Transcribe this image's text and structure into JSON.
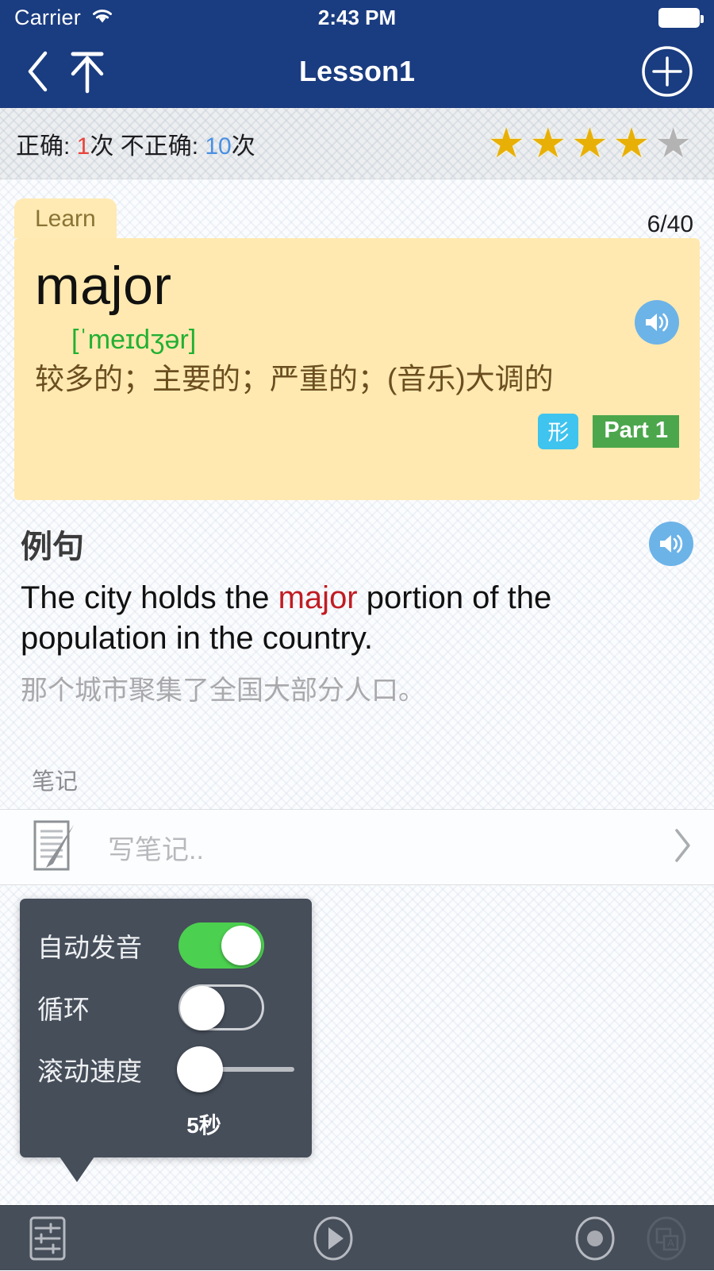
{
  "status_bar": {
    "carrier": "Carrier",
    "time": "2:43 PM",
    "wifi_icon": "wifi-icon",
    "battery_icon": "battery-full-icon"
  },
  "nav_bar": {
    "title": "Lesson1",
    "back_icon": "chevron-left-icon",
    "scroll_to_top_icon": "arrow-up-to-line-icon",
    "add_icon": "plus-circle-icon"
  },
  "stats": {
    "correct_label": "正确: ",
    "correct_count": "1",
    "correct_unit": "次 ",
    "incorrect_label": "不正确: ",
    "incorrect_count": "10",
    "incorrect_unit": "次",
    "stars_filled": 4,
    "stars_total": 5,
    "star_filled_color": "#e8b006",
    "star_empty_color": "#b3b3b3"
  },
  "card": {
    "tab_label": "Learn",
    "counter": "6/40",
    "word": "major",
    "phonetic": "[ˈmeɪdʒər]",
    "definition": "较多的；主要的；严重的；(音乐)大调的",
    "pos_badge": "形",
    "part_badge": "Part 1",
    "speaker_icon": "speaker-icon",
    "card_color": "#ffe9b0",
    "phonetic_color": "#22b032",
    "pos_badge_color": "#3fc3ef",
    "part_badge_color": "#4ca64c"
  },
  "example": {
    "title": "例句",
    "sentence_before": "The city holds the ",
    "sentence_highlight": "major",
    "sentence_after": " portion of the population in the country.",
    "translation": "那个城市聚集了全国大部分人口。",
    "speaker_icon": "speaker-icon",
    "highlight_color": "#c01c22"
  },
  "notes": {
    "section_label": "笔记",
    "placeholder": "写笔记..",
    "icon": "note-pencil-icon",
    "chevron_icon": "chevron-right-icon"
  },
  "settings_popover": {
    "auto_pronounce": {
      "label": "自动发音",
      "state": "on"
    },
    "loop": {
      "label": "循环",
      "state": "off"
    },
    "scroll_speed": {
      "label": "滚动速度",
      "value": "5秒",
      "position_percent": 0
    },
    "switch_on_color": "#4cd050",
    "panel_color": "#464e5a"
  },
  "bottom_bar": {
    "settings_icon": "sliders-icon",
    "play_icon": "play-circle-icon",
    "record_icon": "record-circle-icon",
    "flip_card_icon": "translate-card-icon"
  }
}
